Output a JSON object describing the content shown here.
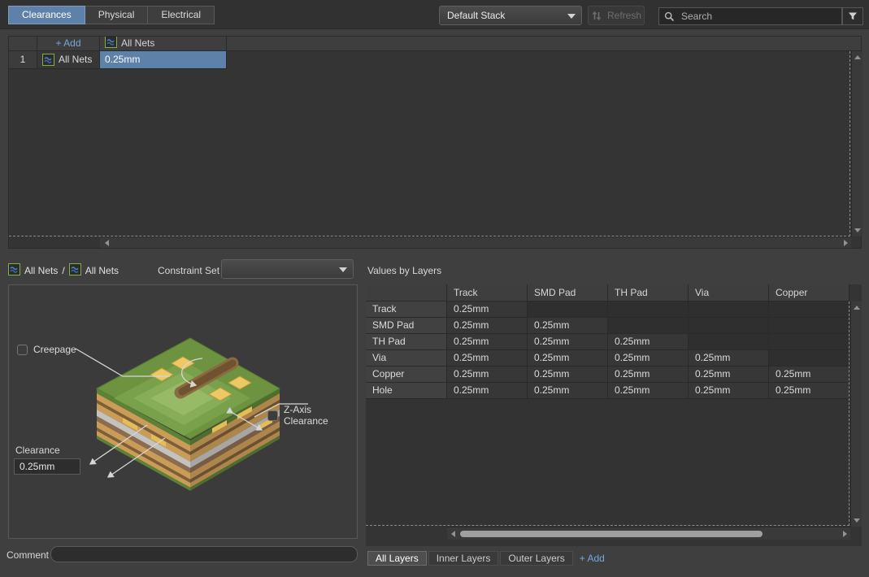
{
  "tabs": [
    {
      "label": "Clearances",
      "active": true
    },
    {
      "label": "Physical",
      "active": false
    },
    {
      "label": "Electrical",
      "active": false
    }
  ],
  "toolbar": {
    "stack_selector_value": "Default Stack",
    "refresh_label": "Refresh",
    "search_placeholder": "Search"
  },
  "rules_table": {
    "add_label": "+ Add",
    "value_column_header": "All Nets",
    "rows": [
      {
        "row_number": "1",
        "net_class": "All Nets",
        "clearance": "0.25mm",
        "selected": true
      }
    ]
  },
  "selection": {
    "net_a": "All Nets",
    "separator": "/",
    "net_b": "All Nets"
  },
  "constraint_set": {
    "label": "Constraint Set",
    "value": ""
  },
  "detail": {
    "creepage_label": "Creepage",
    "creepage_checked": false,
    "zaxis_label": "Z-Axis Clearance",
    "zaxis_checked": false,
    "clearance_label": "Clearance",
    "clearance_value": "0.25mm",
    "comment_label": "Comment",
    "comment_value": ""
  },
  "values_by_layers": {
    "title": "Values by Layers",
    "columns": [
      "Track",
      "SMD Pad",
      "TH Pad",
      "Via",
      "Copper"
    ],
    "rows": [
      {
        "label": "Track",
        "values": [
          "0.25mm",
          "",
          "",
          "",
          ""
        ]
      },
      {
        "label": "SMD Pad",
        "values": [
          "0.25mm",
          "0.25mm",
          "",
          "",
          ""
        ]
      },
      {
        "label": "TH Pad",
        "values": [
          "0.25mm",
          "0.25mm",
          "0.25mm",
          "",
          ""
        ]
      },
      {
        "label": "Via",
        "values": [
          "0.25mm",
          "0.25mm",
          "0.25mm",
          "0.25mm",
          ""
        ]
      },
      {
        "label": "Copper",
        "values": [
          "0.25mm",
          "0.25mm",
          "0.25mm",
          "0.25mm",
          "0.25mm"
        ]
      },
      {
        "label": "Hole",
        "values": [
          "0.25mm",
          "0.25mm",
          "0.25mm",
          "0.25mm",
          "0.25mm"
        ]
      }
    ],
    "layer_tabs": [
      {
        "label": "All Layers",
        "active": true
      },
      {
        "label": "Inner Layers",
        "active": false
      },
      {
        "label": "Outer Layers",
        "active": false
      }
    ],
    "add_label": "+ Add"
  },
  "icons": {
    "net_class": "green-box-blue-waves",
    "search": "magnifier",
    "filter": "funnel",
    "refresh": "up-down-sync-arrows",
    "stack_dropdown": "chevron-down",
    "constraint_dropdown": "chevron-down"
  },
  "colors": {
    "background": "#3f3f3f",
    "topbar": "#313131",
    "tab_active_blue": "#5d81a8",
    "selection_blue": "#5d82aa",
    "link_blue": "#74a7dc",
    "net_icon_green": "#7cb342",
    "net_icon_wave_blue": "#4d7fbe",
    "pcb_green": "#6e9340",
    "pad_yellow": "#ecc963"
  }
}
